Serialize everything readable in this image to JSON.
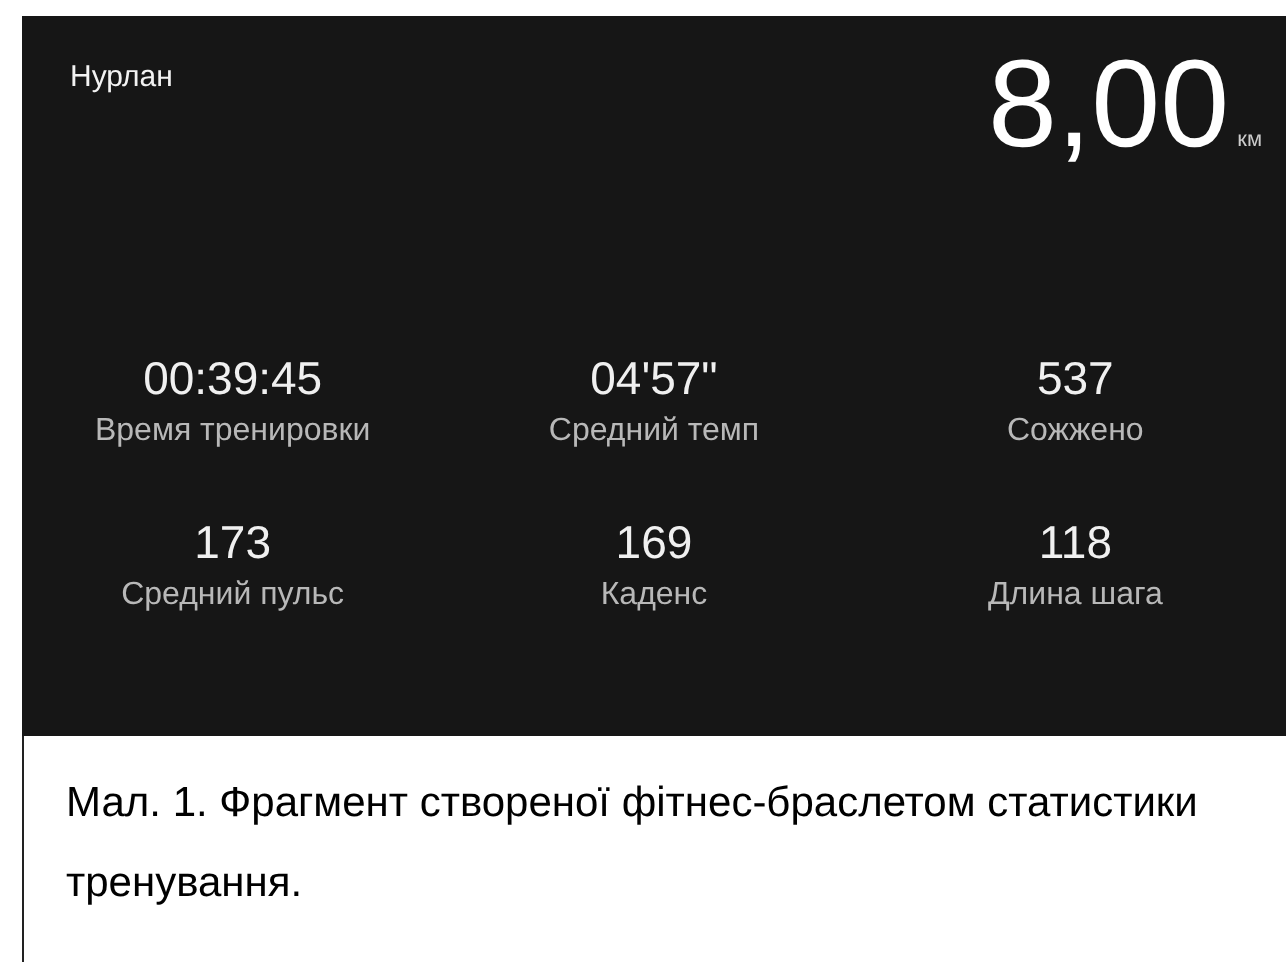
{
  "header": {
    "name": "Нурлан",
    "distance": "8,00",
    "unit": "км"
  },
  "stats": [
    {
      "value": "00:39:45",
      "label": "Время тренировки"
    },
    {
      "value": "04'57\"",
      "label": "Средний темп"
    },
    {
      "value": "537",
      "label": "Сожжено"
    },
    {
      "value": "173",
      "label": "Средний пульс"
    },
    {
      "value": "169",
      "label": "Каденс"
    },
    {
      "value": "118",
      "label": "Длина шага"
    }
  ],
  "caption": "Мал. 1. Фрагмент створеної фітнес-браслетом статистики тренування."
}
